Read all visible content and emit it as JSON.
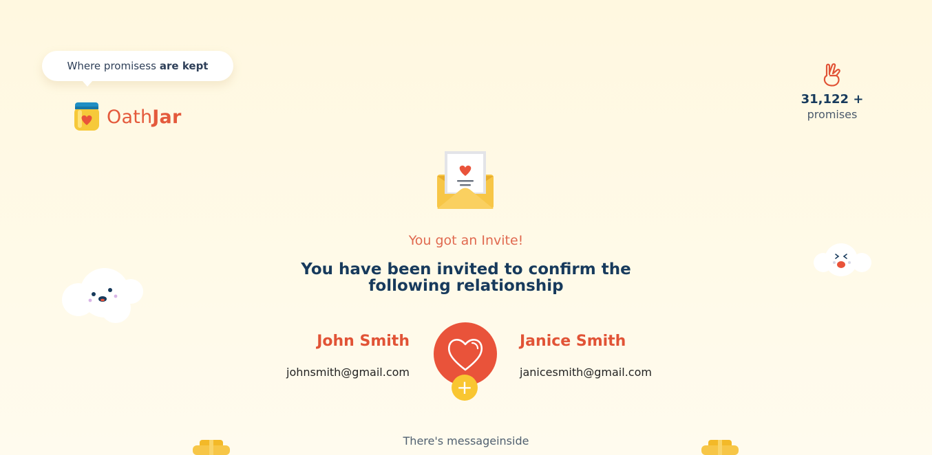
{
  "header": {
    "tagline_prefix": "Where promisess",
    "tagline_bold": "are kept",
    "logo_part1": "Oath",
    "logo_part2": "Jar"
  },
  "stats": {
    "count": "31,122 +",
    "label": "promises",
    "icon": "crossed-fingers-icon"
  },
  "invite": {
    "eyebrow": "You got an Invite!",
    "headline": "You have been invited to confirm the following relationship"
  },
  "people": [
    {
      "name": "John Smith",
      "email": "johnsmith@gmail.com"
    },
    {
      "name": "Janice Smith",
      "email": "janicesmith@gmail.com"
    }
  ],
  "actions": {
    "plus": "+"
  },
  "footer": {
    "message": "There's messageinside"
  },
  "colors": {
    "background": "#fff9e3",
    "accent": "#e9533a",
    "navy": "#173a5c",
    "yellow": "#f9c631"
  }
}
